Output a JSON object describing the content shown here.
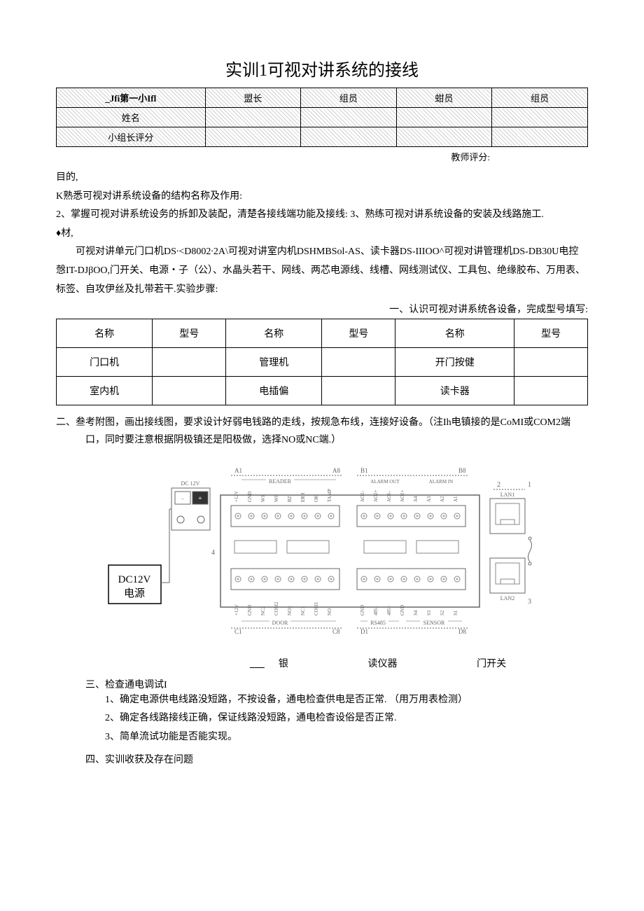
{
  "title": "实训1可视对讲系统的接线",
  "group_table": {
    "header": [
      "_Jfi第一小Ifl",
      "盟长",
      "组员",
      "蚶员",
      "组员"
    ],
    "rows": [
      {
        "label": "姓名"
      },
      {
        "label": "小组长评分"
      }
    ]
  },
  "teacher_score_label": "教师评分:",
  "section_purpose": "目的,",
  "purpose_item1": "K熟悉可视对讲系统设备的结构名称及作用:",
  "purpose_item2": "2、掌握可视对讲系统设务的拆卸及装配，清楚各接线端功能及接线: 3、熟练可视对讲系统设备的安装及线路施工.",
  "section_material": "♦材,",
  "material_text": "可视对讲单元门口机DS∙<D8002∙2A\\可视对讲室内机DSHMBSol-AS、读卡器DS-IIIOO^可视对讲管理机DS-DB30U电控愨IT-DJβOO,门开关、电源・子（公）、水晶头若干、网线、两芯电源线、线槽、网线测试仪、工具包、绝缘胶布、万用表、标签、自攻伊丝及扎带若干.实验步骤:",
  "task1_label": "一、认识可视对讲系统各设备，完成型号填写:",
  "model_table": {
    "headers": [
      "名称",
      "型号",
      "名称",
      "型号",
      "名称",
      "型号"
    ],
    "rows": [
      [
        "门口机",
        "",
        "管理机",
        "",
        "开门按健",
        ""
      ],
      [
        "室内机",
        "",
        "电插偏",
        "",
        "读卡器",
        ""
      ]
    ]
  },
  "task2_text": "二、叁考附图，画出接线图，要求设计好弱电钱路的走线，按规急布线，连接好设备。（注Ih电镇接的是CoMI或COM2端口，同时要注意根据阴极镇还是阳极做，选择NO或NC端.）",
  "diagram": {
    "power_label": "DC12V\n电源",
    "dc_label": "DC 12V",
    "a_labels": {
      "left": "A1",
      "right": "A8"
    },
    "b_labels": {
      "left": "B1",
      "right": "B8"
    },
    "c_labels": {
      "left": "C1",
      "right": "C8"
    },
    "d_labels": {
      "left": "D1",
      "right": "D8"
    },
    "reader_label": "READER",
    "alarm_out_label": "ALARM OUT",
    "alarm_in_label": "ALARM IN",
    "door_label": "DOOR",
    "rs485_label": "RS485",
    "sensor_label": "SENSOR",
    "lan1_label": "LAN1",
    "lan2_label": "LAN2",
    "top_pins_a": [
      "+12V",
      "GND",
      "W1",
      "W0",
      "BZ",
      "ERR",
      "OK",
      "TAMP"
    ],
    "top_pins_b": [
      "AO2-",
      "AO2+",
      "AO1-",
      "AO1+",
      "A4",
      "A3",
      "A2",
      "A1"
    ],
    "bottom_pins_c": [
      "+12V",
      "GND",
      "NC2",
      "COM2",
      "NO2",
      "NC1",
      "COM1",
      "NO1"
    ],
    "bottom_pins_d": [
      "GND",
      "485-",
      "485+",
      "GND",
      "S4",
      "S3",
      "S2",
      "S1"
    ],
    "num1": "1",
    "num2": "2",
    "num3": "3",
    "num4": "4"
  },
  "bottom_labels": {
    "silver": "银",
    "reader": "读仪器",
    "door_switch": "门开关"
  },
  "task3_head": "三、检查通电调试I",
  "task3_items": [
    "1、确定电源供电线路没短路，不按设备，通电检查供电是否正常. （用万用表检测）",
    "2、确定各线路接线正确，保证线路没短路，通电检杳设俗是否正常.",
    "3、简单流试功能是否能实现。"
  ],
  "task4": "四、实训收获及存在问题"
}
